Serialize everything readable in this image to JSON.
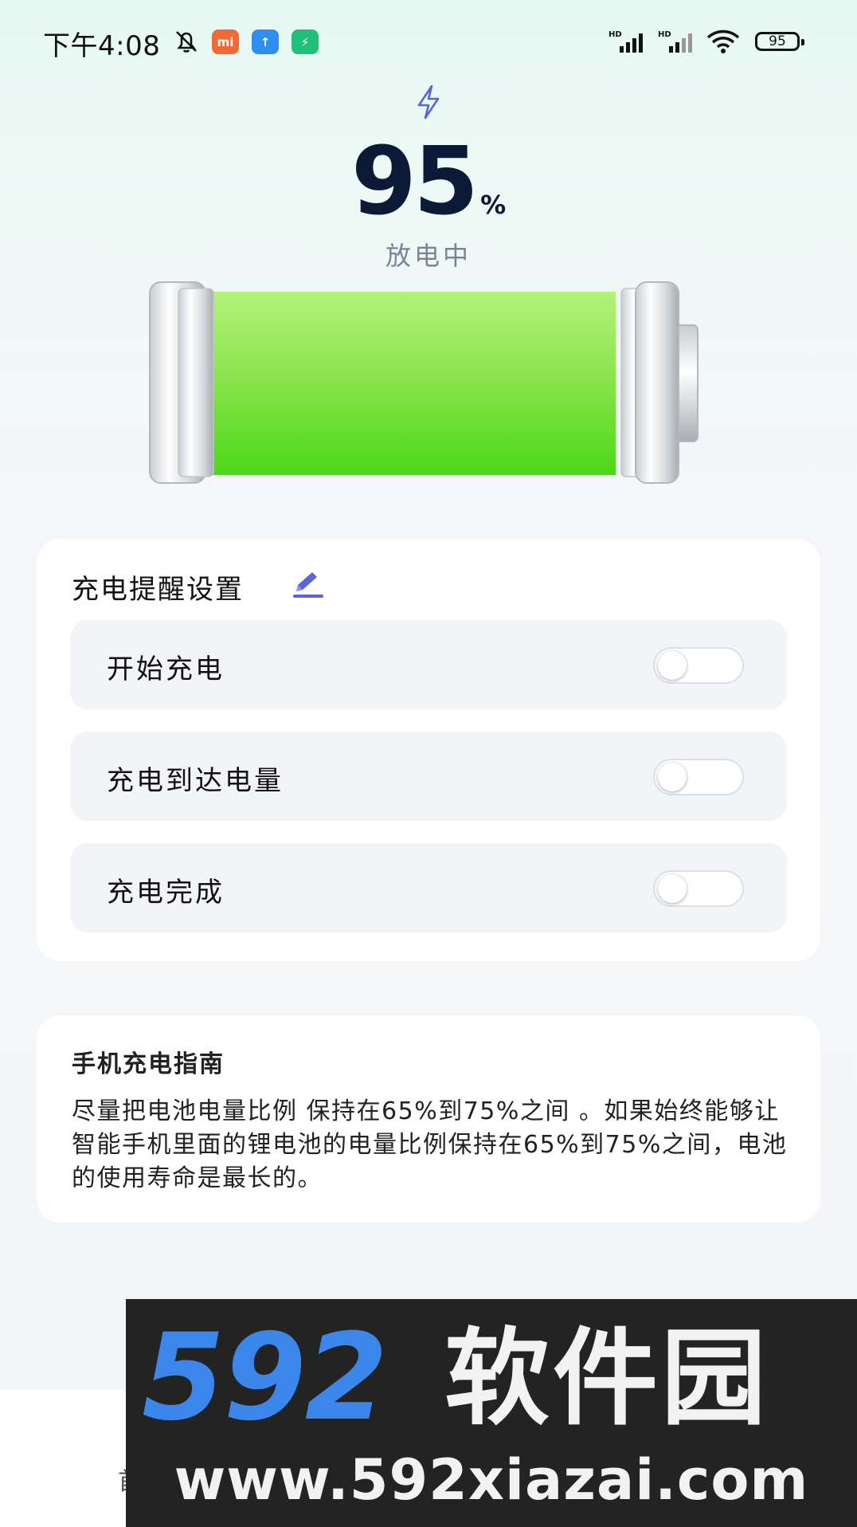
{
  "status_bar": {
    "time": "下午4:08",
    "battery_level": "95",
    "notif_icons": [
      "mi-app-icon",
      "upload-app-icon",
      "security-app-icon"
    ],
    "signal_label": "HD"
  },
  "battery_panel": {
    "percent": "95",
    "unit": "%",
    "status": "放电中",
    "level_fraction": 0.95,
    "fill_color": "#7be13a"
  },
  "settings": {
    "title": "充电提醒设置",
    "rows": [
      {
        "label": "开始充电",
        "enabled": false
      },
      {
        "label": "充电到达电量",
        "enabled": false
      },
      {
        "label": "充电完成",
        "enabled": false
      }
    ]
  },
  "guide": {
    "title": "手机充电指南",
    "text": "尽量把电池电量比例 保持在65%到75%之间 。如果始终能够让智能手机里面的锂电池的电量比例保持在65%到75%之间，电池的使用寿命是最长的。"
  },
  "bottom_nav": {
    "home_label": "首"
  },
  "watermark": {
    "brand_number": "592",
    "brand_cn": "软件园",
    "url": "www.592xiazai.com"
  },
  "colors": {
    "accent": "#5b63d8",
    "text_dark": "#0c1a38",
    "battery_green": "#7be13a"
  }
}
